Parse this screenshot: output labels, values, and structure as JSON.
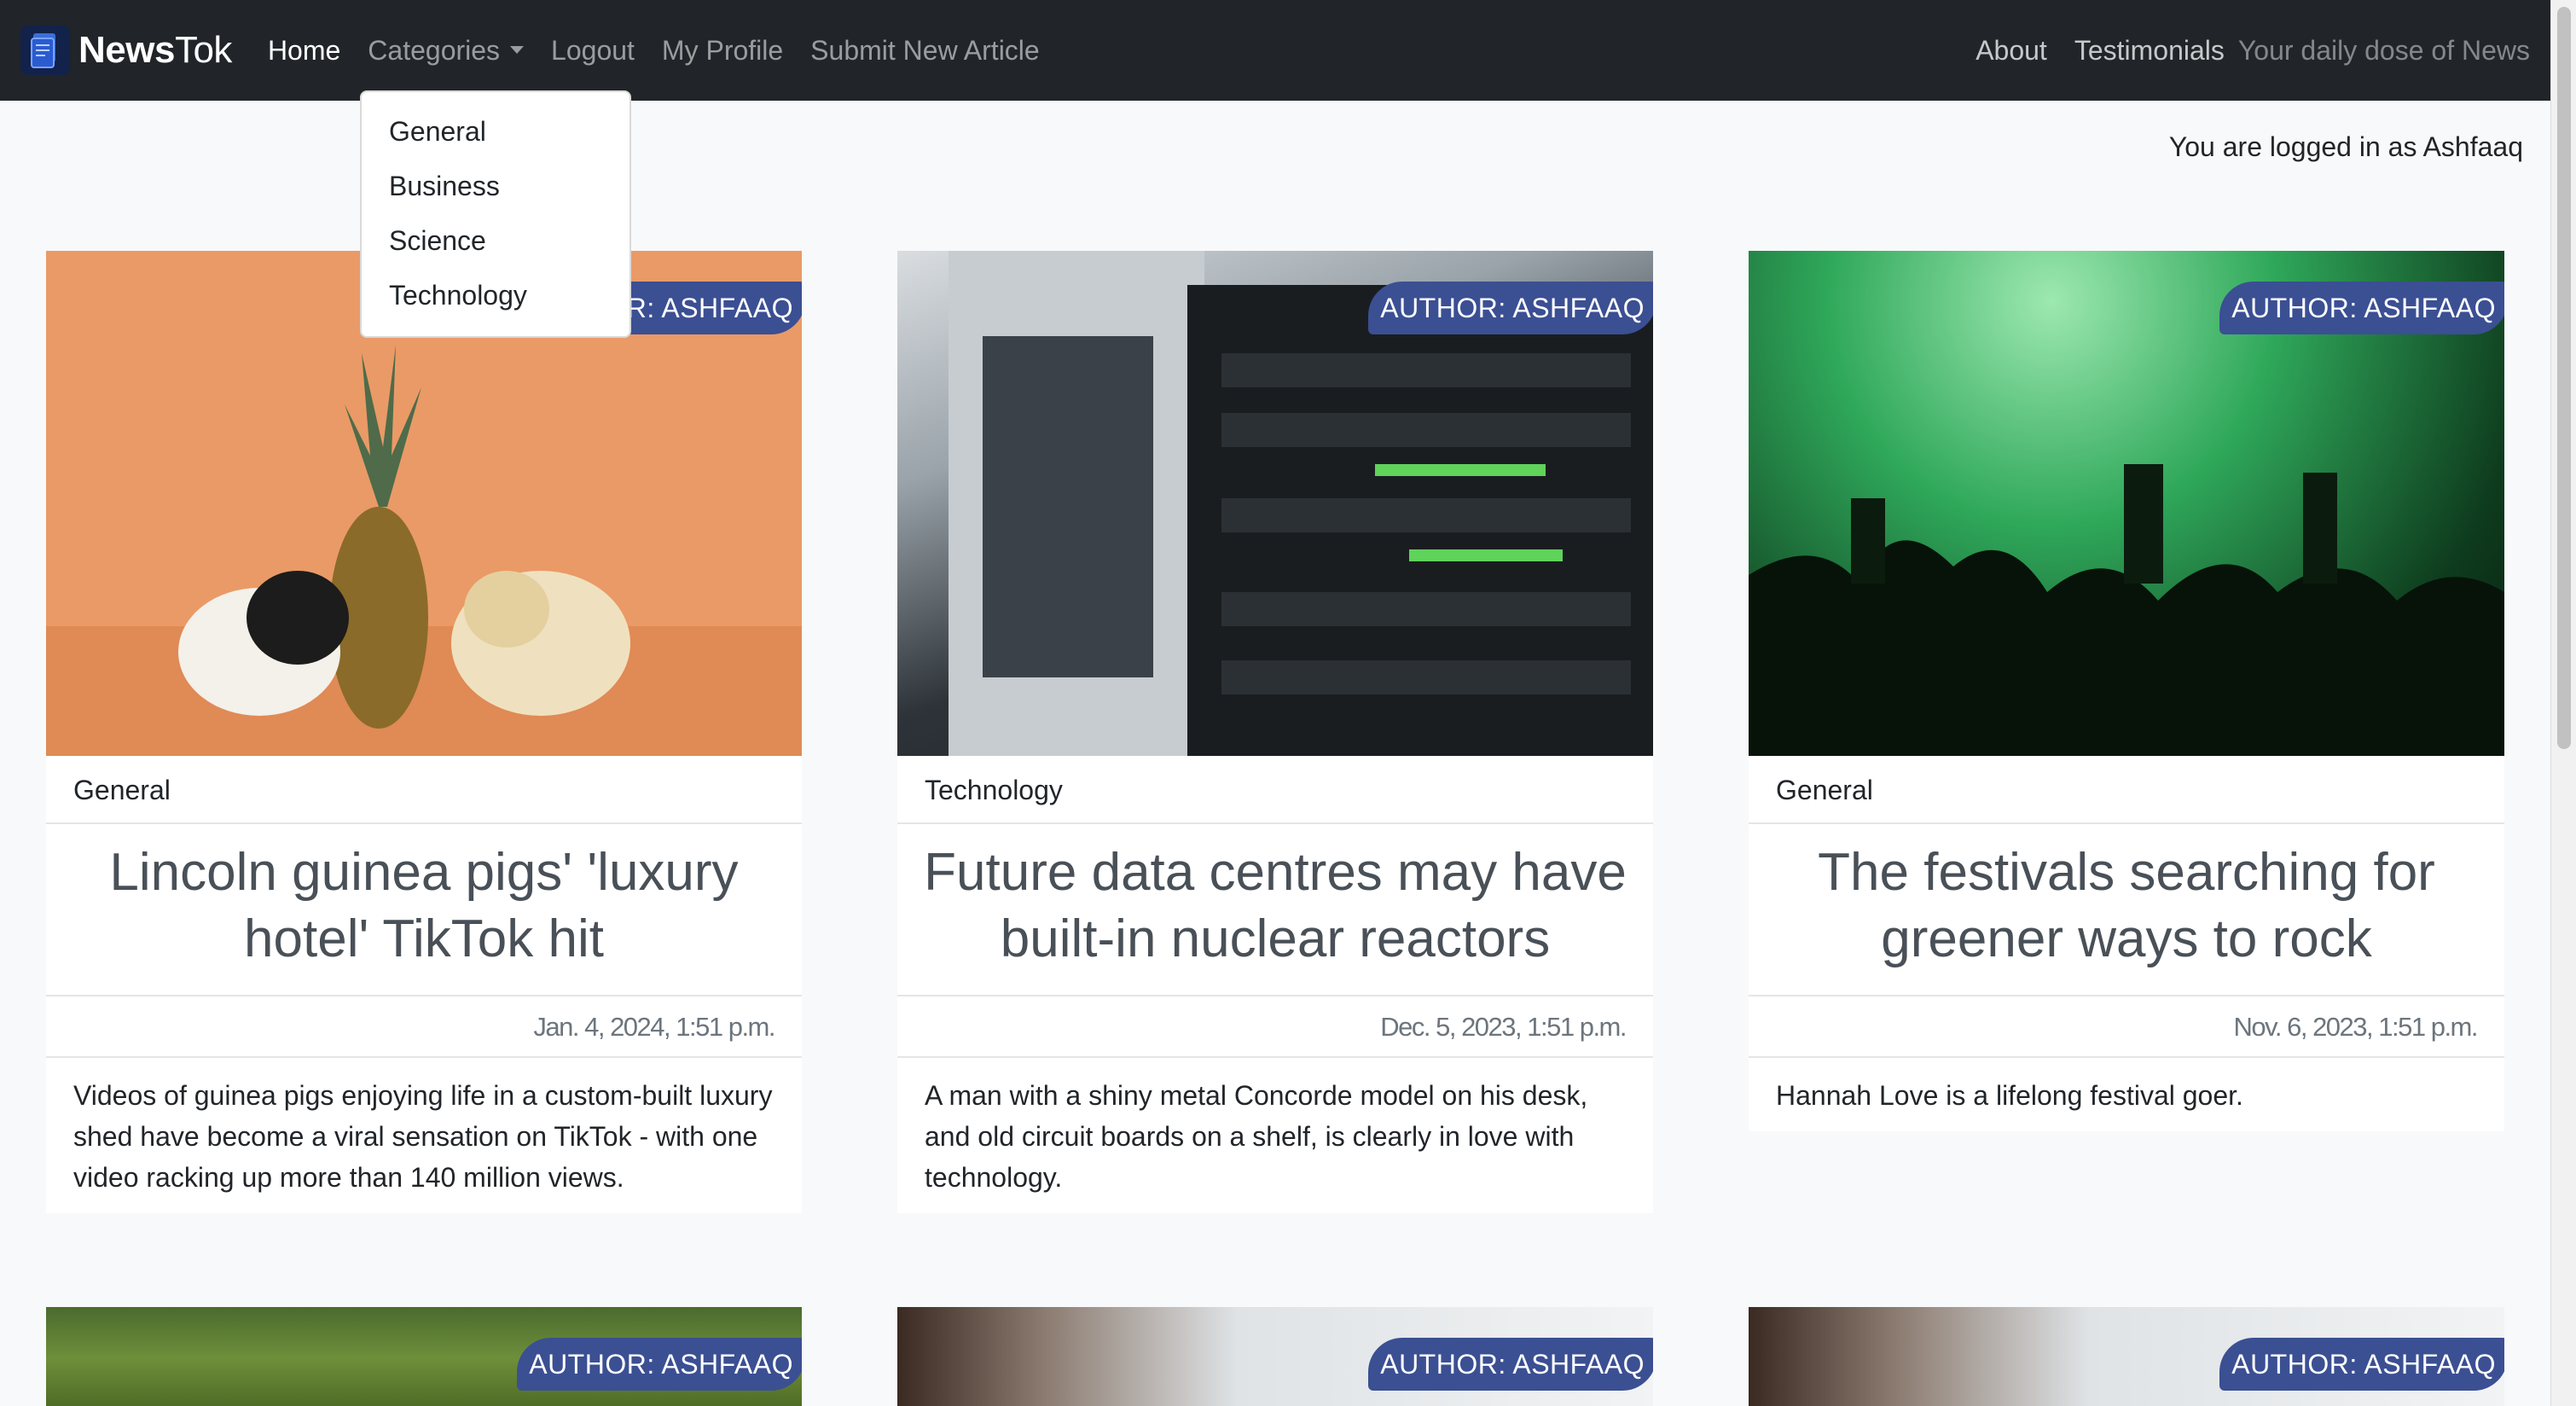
{
  "navbar": {
    "brand_bold": "News",
    "brand_light": "Tok",
    "links": {
      "home": "Home",
      "categories": "Categories",
      "logout": "Logout",
      "profile": "My Profile",
      "submit": "Submit New Article",
      "about": "About",
      "testimonials": "Testimonials"
    },
    "tagline": "Your daily dose of News"
  },
  "categories_dropdown": [
    "General",
    "Business",
    "Science",
    "Technology"
  ],
  "login_status": "You are logged in as Ashfaaq",
  "articles": [
    {
      "author_badge": "AUTHOR: ASHFAAQ",
      "category": "General",
      "title": "Lincoln guinea pigs' 'luxury hotel' TikTok hit",
      "date": "Jan. 4, 2024, 1:51 p.m.",
      "summary": "Videos of guinea pigs enjoying life in a custom-built luxury shed have become a viral sensation on TikTok - with one video racking up more than 140 million views."
    },
    {
      "author_badge": "AUTHOR: ASHFAAQ",
      "category": "Technology",
      "title": "Future data centres may have built-in nuclear reactors",
      "date": "Dec. 5, 2023, 1:51 p.m.",
      "summary": "A man with a shiny metal Concorde model on his desk, and old circuit boards on a shelf, is clearly in love with technology."
    },
    {
      "author_badge": "AUTHOR: ASHFAAQ",
      "category": "General",
      "title": "The festivals searching for greener ways to rock",
      "date": "Nov. 6, 2023, 1:51 p.m.",
      "summary": "Hannah Love is a lifelong festival goer."
    },
    {
      "author_badge": "AUTHOR: ASHFAAQ"
    },
    {
      "author_badge": "AUTHOR: ASHFAAQ"
    },
    {
      "author_badge": "AUTHOR: ASHFAAQ"
    }
  ]
}
